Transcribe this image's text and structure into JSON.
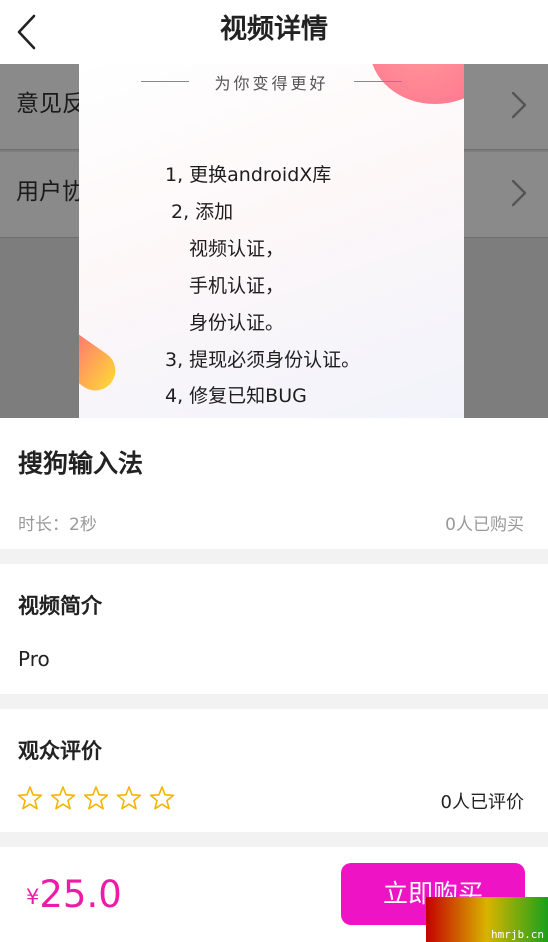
{
  "header": {
    "title": "视频详情",
    "back_icon": "chevron-left-icon"
  },
  "preview": {
    "background_rows": [
      {
        "label": "意见反",
        "icon": "chevron-right-icon"
      },
      {
        "label": "用户协",
        "icon": "chevron-right-icon"
      }
    ],
    "banner": "为你变得更好",
    "notes": [
      "1, 更换androidX库",
      "2, 添加",
      "视频认证，",
      "手机认证，",
      "身份认证。",
      "3, 提现必须身份认证。",
      "4, 修复已知BUG"
    ]
  },
  "video": {
    "title": "搜狗输入法",
    "duration": "时长：2秒",
    "purchases": "0人已购买"
  },
  "intro": {
    "heading": "视频简介",
    "text": "Pro"
  },
  "reviews": {
    "heading": "观众评价",
    "rating": 0,
    "max_rating": 5,
    "count": "0人已评价",
    "star_icon": "star-outline-icon",
    "star_color": "#f5b400"
  },
  "footer": {
    "currency": "¥",
    "price": "25.0",
    "buy_label": "立即购买"
  },
  "watermark": {
    "text": "hmrjb.cn"
  },
  "colors": {
    "accent": "#ee14c6",
    "price": "#ee1aa8",
    "muted_text": "#999999",
    "section_gap": "#f2f2f2"
  }
}
